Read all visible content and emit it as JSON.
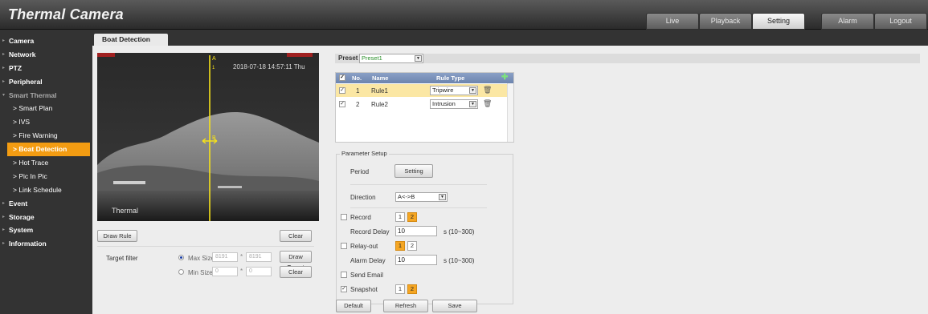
{
  "app": {
    "title": "Thermal Camera"
  },
  "topnav": [
    {
      "label": "Live",
      "active": false
    },
    {
      "label": "Playback",
      "active": false
    },
    {
      "label": "Setting",
      "active": true
    },
    {
      "label": "Alarm",
      "active": false
    },
    {
      "label": "Logout",
      "active": false
    }
  ],
  "sidebar": {
    "items": [
      {
        "label": "Camera",
        "kind": "top"
      },
      {
        "label": "Network",
        "kind": "top"
      },
      {
        "label": "PTZ",
        "kind": "top"
      },
      {
        "label": "Peripheral",
        "kind": "top"
      },
      {
        "label": "Smart Thermal",
        "kind": "top-open"
      },
      {
        "label": "Smart Plan",
        "kind": "sub"
      },
      {
        "label": "IVS",
        "kind": "sub"
      },
      {
        "label": "Fire Warning",
        "kind": "sub"
      },
      {
        "label": "Boat Detection",
        "kind": "selected"
      },
      {
        "label": "Hot Trace",
        "kind": "sub"
      },
      {
        "label": "Pic In Pic",
        "kind": "sub"
      },
      {
        "label": "Link Schedule",
        "kind": "sub"
      },
      {
        "label": "Event",
        "kind": "top"
      },
      {
        "label": "Storage",
        "kind": "top"
      },
      {
        "label": "System",
        "kind": "top"
      },
      {
        "label": "Information",
        "kind": "top"
      }
    ]
  },
  "tab": {
    "label": "Boat Detection"
  },
  "video": {
    "timestamp": "2018-07-18 14:57:11 Thu",
    "label": "Thermal",
    "line_markers": [
      "A",
      "B"
    ],
    "line_numbers": [
      "1",
      "1"
    ]
  },
  "left_controls": {
    "draw_rule": "Draw Rule",
    "clear_top": "Clear",
    "target_filter": "Target filter",
    "max_size_label": "Max Size",
    "max_w": "8191",
    "max_h": "8191",
    "min_size_label": "Min Size",
    "min_w": "0",
    "min_h": "0",
    "sep": "*",
    "draw_target": "Draw Target",
    "clear_bottom": "Clear"
  },
  "preset": {
    "label": "Preset",
    "value": "Preset1"
  },
  "rule_table": {
    "headers": {
      "no": "No.",
      "name": "Name",
      "type": "Rule Type"
    },
    "rows": [
      {
        "checked": true,
        "no": "1",
        "name": "Rule1",
        "type": "Tripwire",
        "selected": true
      },
      {
        "checked": true,
        "no": "2",
        "name": "Rule2",
        "type": "Intrusion",
        "selected": false
      }
    ]
  },
  "params": {
    "legend": "Parameter Setup",
    "period_label": "Period",
    "setting_btn": "Setting",
    "direction_label": "Direction",
    "direction_value": "A<->B",
    "record_label": "Record",
    "record_delay_label": "Record Delay",
    "record_delay_value": "10",
    "record_delay_range": "s (10~300)",
    "relay_label": "Relay-out",
    "alarm_delay_label": "Alarm Delay",
    "alarm_delay_value": "10",
    "alarm_delay_range": "s (10~300)",
    "email_label": "Send Email",
    "snapshot_label": "Snapshot",
    "n1": "1",
    "n2": "2"
  },
  "footer_btns": {
    "default": "Default",
    "refresh": "Refresh",
    "save": "Save"
  },
  "colors": {
    "accent": "#f39c12",
    "line": "#f5e11a"
  }
}
